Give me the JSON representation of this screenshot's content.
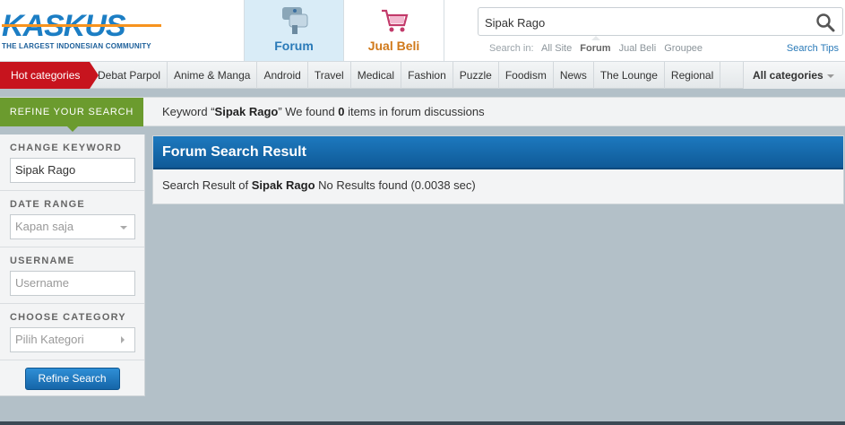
{
  "header": {
    "logo_text": "KASKUS",
    "logo_tagline": "THE LARGEST INDONESIAN COMMUNITY",
    "nav": [
      {
        "label": "Forum",
        "icon": "forum-icon"
      },
      {
        "label": "Jual Beli",
        "icon": "shopping-cart-icon"
      }
    ]
  },
  "search": {
    "value": "Sipak Rago",
    "search_in_label": "Search in:",
    "options": [
      "All Site",
      "Forum",
      "Jual Beli",
      "Groupee"
    ],
    "active_option": "Forum",
    "tips_label": "Search Tips"
  },
  "categories": {
    "hot_label": "Hot categories",
    "items": [
      "Debat Parpol",
      "Anime & Manga",
      "Android",
      "Travel",
      "Medical",
      "Fashion",
      "Puzzle",
      "Foodism",
      "News",
      "The Lounge",
      "Regional"
    ],
    "all_label": "All categories"
  },
  "refine": {
    "tab_label": "REFINE YOUR SEARCH",
    "msg_prefix": "Keyword “",
    "msg_keyword": "Sipak Rago",
    "msg_middle": "” We found ",
    "msg_count": "0",
    "msg_suffix": " items in forum discussions"
  },
  "sidebar": {
    "keyword_title": "CHANGE KEYWORD",
    "keyword_value": "Sipak Rago",
    "date_title": "DATE RANGE",
    "date_value": "Kapan saja",
    "username_title": "USERNAME",
    "username_placeholder": "Username",
    "category_title": "CHOOSE CATEGORY",
    "category_value": "Pilih Kategori",
    "button_label": "Refine Search"
  },
  "result": {
    "title": "Forum Search Result",
    "prefix": "Search Result of ",
    "keyword": "Sipak Rago",
    "suffix": " No Results found (0.0038 sec)"
  },
  "colors": {
    "brand_blue": "#1c7ec4",
    "hot_red": "#c7141e",
    "refine_green": "#6b9b2e",
    "result_header": "#1d79bf"
  }
}
